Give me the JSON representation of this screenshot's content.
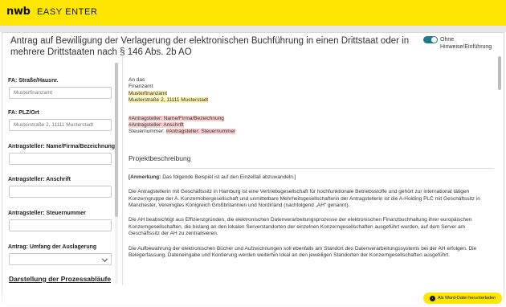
{
  "header": {
    "logo": "nwb",
    "app_name": "EASY ENTER"
  },
  "page": {
    "title": "Antrag auf Bewilligung der Verlagerung der elektronischen Buchführung in einen Drittstaat oder in mehrere Drittstaaten nach § 146 Abs. 2b AO",
    "toggle_label": "Ohne Hinweise/Einführung",
    "toggle_on": true
  },
  "form": {
    "fields": [
      {
        "label": "FA: Straße/Hausnr.",
        "placeholder": "Musterfinanzamt"
      },
      {
        "label": "FA: PLZ/Ort",
        "placeholder": "Musterstraße 2, 11111 Musterstadt"
      },
      {
        "label": "Antragsteller: Name/Firma/Bezeichnung",
        "placeholder": ""
      },
      {
        "label": "Antragsteller: Anschrift",
        "placeholder": ""
      },
      {
        "label": "Antragsteller: Steuernummer",
        "placeholder": ""
      },
      {
        "label": "Antrag: Umfang der Auslagerung",
        "placeholder": ""
      }
    ],
    "section_link": "Darstellung der Prozessabläufe"
  },
  "document": {
    "addr_line1": "An das",
    "addr_line2": "Finanzamt",
    "addr_fa_name": "Musterfinanzamt",
    "addr_fa_street": "Musterstraße 2, 11111 Musterstadt",
    "ph_name": "#Antragsteller: Name/Firma/Bezeichnung",
    "ph_address": "#Antragsteller: Anschrift",
    "steuer_label": "Steuernummer:",
    "ph_steuer": "#Antragsteller: Steuernummer",
    "section_heading": "Projektbeschreibung",
    "note_bold": "[Anmerkung:",
    "note_rest": " Das folgende Beispiel ist auf den Einzelfall abzuwandeln.]",
    "para1": "Die Antragstellerin mit Geschäftssitz in Hamburg ist eine Vertriebsgesellschaft für hochfunktionale Betriebsstoffe und gehört zur international tätigen Konzerngruppe der A. Konzernobergesellschaft und unmittelbare Mehrheitsgesellschafterin der Antragstellerin ist die A-Holding PLC mit Geschäftssitz in Manchester, Vereinigtes Königreich Großbritannien und Nordirland (nachfolgend „AH“ genannt).",
    "para2": "Die AH beabsichtigt aus Effizienzgründen, die elektronischen Datenverarbeitungsprozesse der elektronischen Finanzbuchhaltung ihrer europäischen Konzerngesellschaften, die bislang an den lokalen Serverstandorten der einzelnen Konzerngesellschaften ausgeführt wurden, auf dem Server am Geschäftssitz der AH zu zentralisieren.",
    "para3": "Die Aufbewahrung der elektronischen Bücher und Aufzeichnungen soll ebenfalls am Standort des Datenverarbeitungssystems bei der AH erfolgen. Die Belegerfassung, Dateneingabe und Kontierung werden weiterhin lokal an den jeweiligen Standorten der Konzerngesellschaften ausgeführt."
  },
  "download_button": {
    "label": "Als Word-Datei herunterladen",
    "icon": "download-icon"
  },
  "colors": {
    "brand_yellow": "#ffe600",
    "toggle": "#1f7a8c",
    "highlight_filled": "#fff3b0",
    "highlight_placeholder": "#f8d0d0"
  }
}
